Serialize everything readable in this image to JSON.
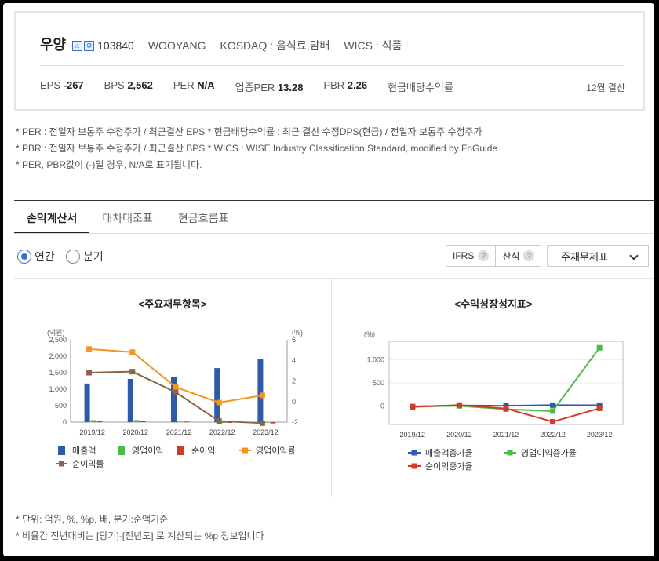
{
  "company": {
    "name": "우양",
    "icon1": "⌂",
    "icon2": "⚙",
    "code": "103840",
    "english_name": "WOOYANG",
    "market": "KOSDAQ : 음식료,담배",
    "wics": "WICS : 식품"
  },
  "metrics": [
    {
      "label": "EPS",
      "value": "-267"
    },
    {
      "label": "BPS",
      "value": "2,562"
    },
    {
      "label": "PER",
      "value": "N/A"
    },
    {
      "label": "업종PER",
      "value": "13.28"
    },
    {
      "label": "PBR",
      "value": "2.26"
    },
    {
      "label": "현금배당수익률",
      "value": ""
    }
  ],
  "fiscal_label": "12월 결산",
  "notes": [
    "* PER : 전일자 보통주 수정주가 / 최근결산 EPS * 현금배당수익률 : 최근 결산 수정DPS(현금) / 전일자 보통주 수정주가",
    "* PBR : 전일자 보통주 수정주가 / 최근결산 BPS * WICS : WISE Industry Classification Standard, modified by FnGuide",
    "* PER, PBR값이 (-)일 경우, N/A로 표기됩니다."
  ],
  "tabs": [
    "손익계산서",
    "대차대조표",
    "현금흐름표"
  ],
  "controls": {
    "radio_annual": "연간",
    "radio_quarter": "분기",
    "ifrs_label": "IFRS",
    "calc_label": "산식",
    "help_glyph": "?",
    "select_value": "주재무제표"
  },
  "chart_data": [
    {
      "type": "bar",
      "title": "<주요재무항목>",
      "ylabel_left": "(억원)",
      "ylabel_right": "(%)",
      "categories": [
        "2019/12",
        "2020/12",
        "2021/12",
        "2022/12",
        "2023/12"
      ],
      "ylim": [
        0,
        2500
      ],
      "yticks": [
        "0",
        "500",
        "1,000",
        "1,500",
        "2,000",
        "2,500"
      ],
      "y2lim": [
        -2,
        6
      ],
      "y2ticks": [
        "-2",
        "0",
        "2",
        "4",
        "6"
      ],
      "series": [
        {
          "name": "매출액",
          "kind": "bar",
          "color": "#2e5aa8",
          "values": [
            1170,
            1310,
            1380,
            1640,
            1920
          ]
        },
        {
          "name": "영업이익",
          "kind": "bar",
          "color": "#4dbb47",
          "values": [
            60,
            62,
            18,
            -20,
            5
          ]
        },
        {
          "name": "순이익",
          "kind": "bar",
          "color": "#d43a2a",
          "values": [
            30,
            40,
            18,
            -6,
            -40
          ]
        },
        {
          "name": "영업이익률",
          "kind": "line",
          "color": "#f7941d",
          "axis": "right",
          "values": [
            5.1,
            4.8,
            1.4,
            -0.1,
            0.6
          ]
        },
        {
          "name": "순이익률",
          "kind": "line",
          "color": "#8b6348",
          "axis": "right",
          "values": [
            2.8,
            2.9,
            0.9,
            -1.9,
            -2.1
          ]
        }
      ]
    },
    {
      "type": "line",
      "title": "<수익성장성지표>",
      "ylabel": "(%)",
      "categories": [
        "2019/12",
        "2020/12",
        "2021/12",
        "2022/12",
        "2023/12"
      ],
      "ylim": [
        -400,
        1400
      ],
      "yticks": [
        "0",
        "500",
        "1,000"
      ],
      "series": [
        {
          "name": "매출액증가율",
          "color": "#2e5aa8",
          "values": [
            -10,
            12,
            5,
            19,
            17
          ]
        },
        {
          "name": "영업이익증가율",
          "color": "#4dbb47",
          "values": [
            -10,
            3,
            -70,
            -110,
            1260
          ]
        },
        {
          "name": "순이익증가율",
          "color": "#d43a2a",
          "values": [
            -20,
            20,
            -55,
            -340,
            -50
          ]
        }
      ]
    }
  ],
  "footer_notes": [
    "* 단위: 억원, %, %p, 배, 분기:순액기준",
    "* 비율간 전년대비는 [당기]-[전년도] 로 계산되는 %p 정보입니다"
  ]
}
